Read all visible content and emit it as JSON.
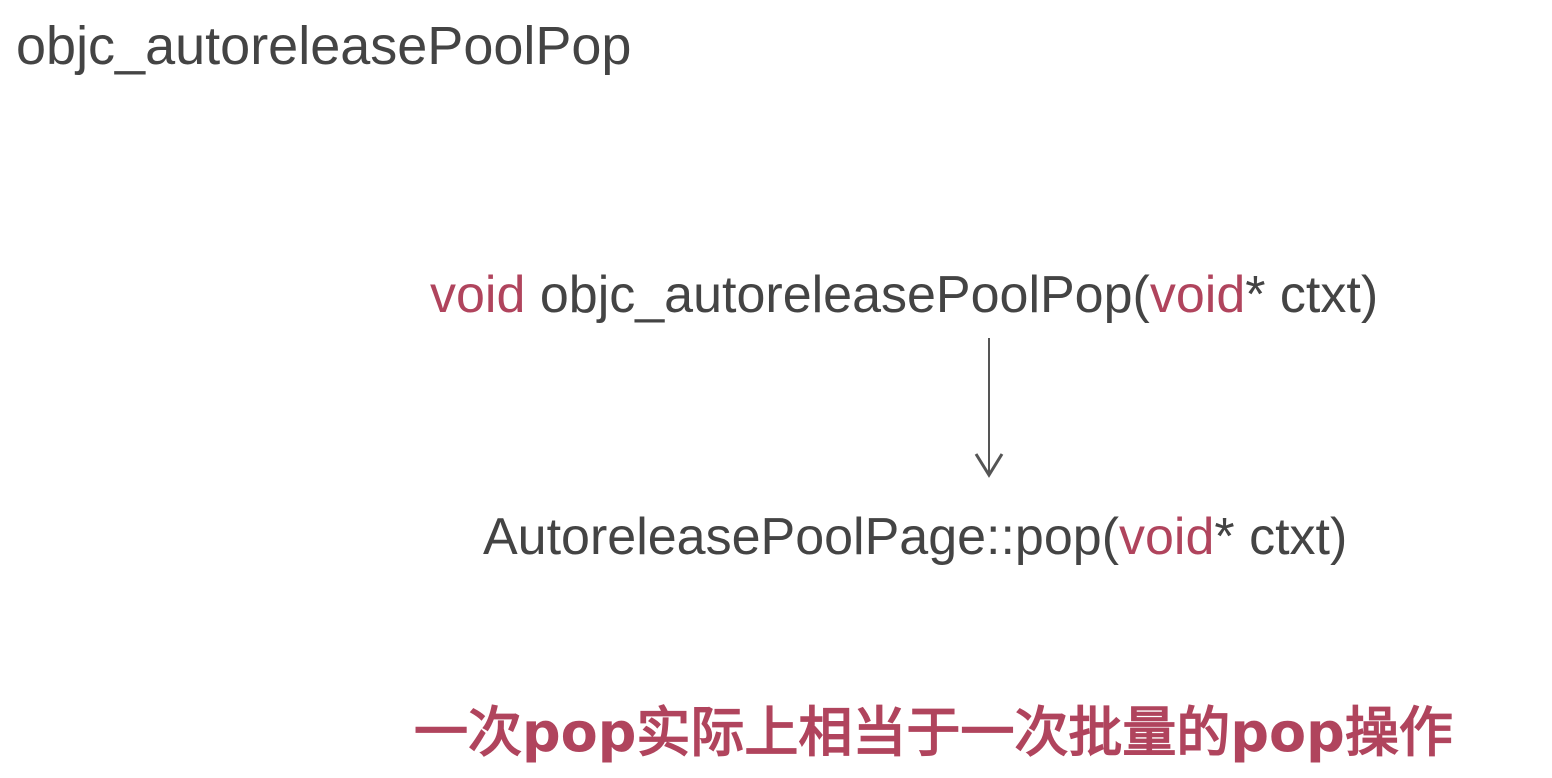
{
  "title": "objc_autoreleasePoolPop",
  "colors": {
    "text": "#444444",
    "keyword": "#b0445d",
    "arrow": "#555555"
  },
  "code": {
    "line1": {
      "keyword": "void",
      "name": " objc_autoreleasePoolPop(",
      "param_type": "void",
      "param_rest": "* ctxt)"
    },
    "line2": {
      "name": "AutoreleasePoolPage::pop(",
      "param_type": "void",
      "param_rest": "* ctxt)"
    }
  },
  "arrow_icon": "down-arrow-icon",
  "summary": "一次pop实际上相当于一次批量的pop操作"
}
